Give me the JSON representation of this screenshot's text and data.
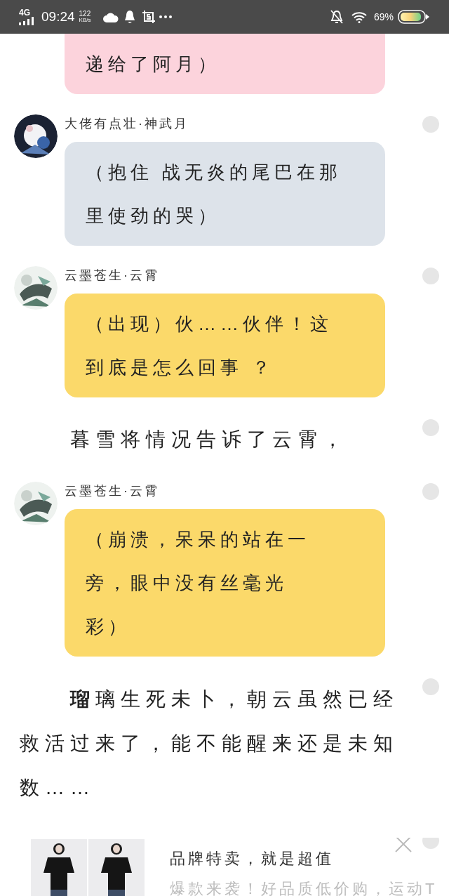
{
  "status_bar": {
    "network": "4G",
    "time": "09:24",
    "speed_value": "122",
    "speed_unit": "KB/s",
    "battery": "69%"
  },
  "messages": [
    {
      "kind": "bubble",
      "color": "#fcd3dc",
      "lines": [
        "递给了阿月）"
      ]
    },
    {
      "kind": "bubble",
      "name": "大佬有点壮·神武月",
      "color": "#dde3ea",
      "lines": [
        "（抱住 战无炎的尾巴在那",
        "里使劲的哭）"
      ]
    },
    {
      "kind": "bubble",
      "name": "云墨苍生·云霄",
      "color": "#fbd96a",
      "lines": [
        "（出现）伙……伙伴！这",
        "到底是怎么回事 ？"
      ]
    },
    {
      "kind": "narration",
      "text": "暮雪将情况告诉了云霄，"
    },
    {
      "kind": "bubble",
      "name": "云墨苍生·云霄",
      "color": "#fbd96a",
      "lines": [
        "（崩溃，呆呆的站在一",
        "旁，眼中没有丝毫光",
        "彩）"
      ]
    },
    {
      "kind": "paragraph",
      "text": "**瑠**璃生死未卜，朝云虽然已经救活过来了，能不能醒来还是未知数……"
    }
  ],
  "ad": {
    "title": "品牌特卖，就是超值",
    "subtitle": "爆款来袭！好品质低价购，运动T"
  }
}
